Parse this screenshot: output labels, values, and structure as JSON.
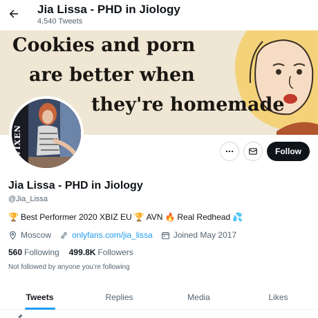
{
  "header": {
    "title": "Jia Lissa - PHD in Jiology",
    "tweet_count": "4,540 Tweets"
  },
  "banner": {
    "line1": "Cookies and porn",
    "line2": "are better when",
    "line3": "they're homemade"
  },
  "avatar": {
    "logo_text": "VIXEN"
  },
  "actions": {
    "follow_label": "Follow"
  },
  "profile": {
    "name": "Jia Lissa - PHD in Jiology",
    "handle": "@Jia_Lissa",
    "bio_part1": "Best Performer 2020 XBIZ EU",
    "bio_part2": "AVN",
    "bio_part3": "Real Redhead",
    "location": "Moscow",
    "website": "onlyfans.com/jia_lissa",
    "joined": "Joined May 2017",
    "following_count": "560",
    "following_label": "Following",
    "followers_count": "499.8K",
    "followers_label": "Followers",
    "not_followed_text": "Not followed by anyone you’re following"
  },
  "tabs": [
    {
      "label": "Tweets"
    },
    {
      "label": "Replies"
    },
    {
      "label": "Media"
    },
    {
      "label": "Likes"
    }
  ],
  "colors": {
    "accent": "#1d9bf0",
    "text": "#0f1419",
    "muted": "#536471"
  }
}
